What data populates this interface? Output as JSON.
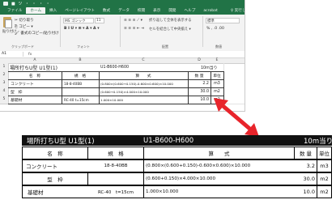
{
  "excel": {
    "title_dots": "■ ツ ・ ・ ・ ・",
    "tabs": [
      "ファイル",
      "ホーム",
      "挿入",
      "ページレイアウト",
      "数式",
      "データ",
      "校閲",
      "表示",
      "開発",
      "ヘルプ",
      "acrobat"
    ],
    "tell_me": "♀ 実行したい作業を入力してください",
    "ribbon": {
      "paste_label": "貼り付け",
      "cut": "✂ 切り取り",
      "copy": "⎘ コピー ▾",
      "format_painter": "🖌 書式のコピー/貼り付け",
      "clipboard_group": "クリップボード",
      "font_name": "MS ゴシック",
      "font_size": "11",
      "font_buttons": "B I U ▾ ⊞ ▾ A ▾ A ▾",
      "font_group": "フォント",
      "wrap": "折り返して全体を表示する",
      "merge": "セルを結合して中央揃え ▾",
      "align_group": "配置",
      "number_format": "標準",
      "number_buttons": "% , .0 .00",
      "number_group": "数値"
    },
    "name_box": "A1",
    "fx": "fx",
    "col_headers": [
      "A",
      "B",
      "C",
      "D",
      "E"
    ],
    "row_headers": [
      "1",
      "2",
      "3",
      "4",
      "5"
    ],
    "rows": [
      {
        "a": "場所打ちU型 U1型(1)",
        "b": "",
        "c": "U1-B600-H600",
        "d": "10m当り",
        "e": ""
      },
      {
        "a": "名　称",
        "b": "規　格",
        "c": "算　　式",
        "d": "数 量",
        "e": "単位"
      },
      {
        "a": "コンクリート",
        "b": "18-8-40BB",
        "c": "(0.800×(0.600+0.150)-0.600×0.600)×10.000",
        "d": "2.2",
        "e": "m3"
      },
      {
        "a": "型　枠",
        "b": "",
        "c": "(0.600+0.150)×4.000×10.000",
        "d": "30.0",
        "e": "m2"
      },
      {
        "a": "基礎材",
        "b": "RC-40 t=15cm",
        "c": "1.000×10.000",
        "d": "10.0",
        "e": "m2"
      }
    ]
  },
  "zoom": {
    "header": {
      "title": "場所打ちU型 U1型(1)",
      "spec": "U1-B600-H600",
      "unit": "10m当り"
    },
    "columns": [
      "名　称",
      "規　格",
      "算　　式",
      "数 量",
      "単位"
    ],
    "rows": [
      {
        "name": "コンクリート",
        "spec": "18-8-40BB",
        "formula": "(0.800×(0.600+0.150)-0.600×0.600)×10.000",
        "qty": "3.2",
        "unit": "m3"
      },
      {
        "name": "型　枠",
        "spec": "",
        "formula": "(0.600+0.150)×4.000×10.000",
        "qty": "30.0",
        "unit": "m2"
      },
      {
        "name": "基礎材",
        "spec": "RC-40　t=15cm",
        "formula": "1.000×10.000",
        "qty": "10.0",
        "unit": "m2"
      }
    ]
  },
  "colors": {
    "excel_green": "#217346",
    "arrow": "#e8242b",
    "header_bg": "#111111"
  }
}
